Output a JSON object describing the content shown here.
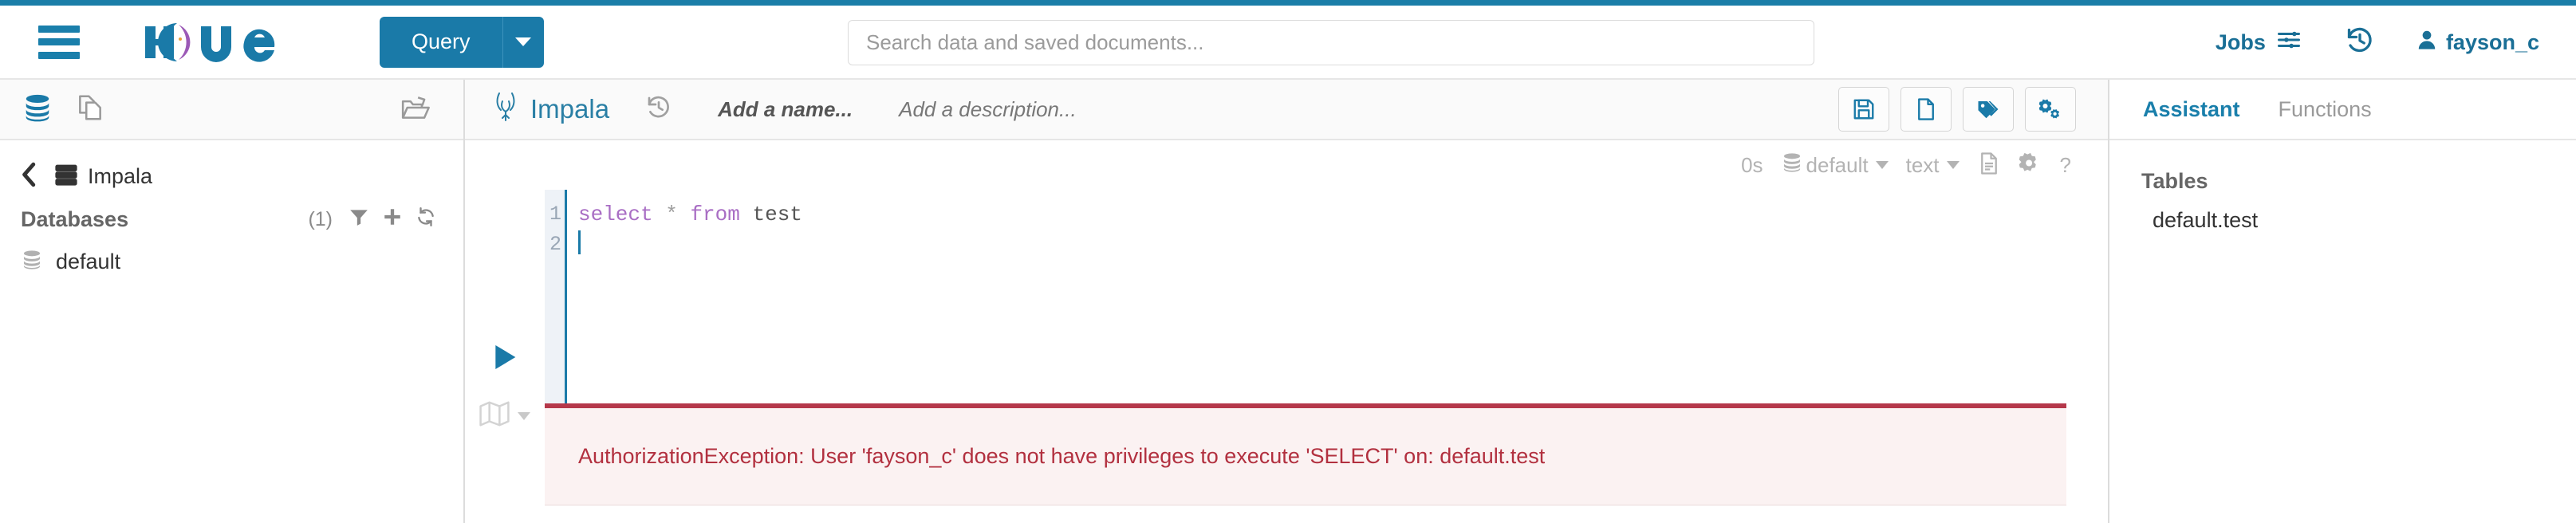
{
  "app": {
    "brand": "Hue",
    "accent_color": "#1a7aa8",
    "error_color": "#b2303f"
  },
  "navbar": {
    "menu_icon": "hamburger-icon",
    "logo_icon": "hue-logo",
    "query_button": "Query",
    "query_caret_icon": "chevron-down-icon",
    "search": {
      "placeholder": "Search data and saved documents...",
      "value": "",
      "icon": "search-icon"
    },
    "jobs_label": "Jobs",
    "jobs_icon": "sliders-icon",
    "history_icon": "history-icon",
    "user_icon": "user-icon",
    "user_name": "fayson_c"
  },
  "left_panel": {
    "header_icons": [
      {
        "name": "database-icon",
        "state": "active"
      },
      {
        "name": "documents-icon",
        "state": "inactive"
      },
      {
        "name": "folder-open-icon",
        "state": "inactive"
      }
    ],
    "back_icon": "chevron-left-icon",
    "source_icon": "server-icon",
    "source_label": "Impala",
    "databases_label": "Databases",
    "databases_count": "(1)",
    "action_icons": [
      "filter-icon",
      "plus-icon",
      "refresh-icon"
    ],
    "databases": [
      {
        "icon": "database-icon",
        "name": "default"
      }
    ]
  },
  "editor": {
    "engine_icon": "impala-logo",
    "engine_name": "Impala",
    "history_icon": "history-icon",
    "name_placeholder": "Add a name...",
    "description_placeholder": "Add a description...",
    "action_buttons": [
      {
        "name": "save-button",
        "icon": "floppy-disk-icon"
      },
      {
        "name": "new-document-button",
        "icon": "file-icon"
      },
      {
        "name": "tags-button",
        "icon": "tags-icon"
      },
      {
        "name": "settings-button",
        "icon": "gears-icon"
      }
    ],
    "toolbar": {
      "duration": "0s",
      "database_icon": "database-icon",
      "database": "default",
      "format": "text",
      "result_icon": "file-text-icon",
      "settings_icon": "gear-icon",
      "help_icon": "question-mark-icon"
    },
    "run_icon": "play-icon",
    "explain_icon": "map-icon",
    "gutter_lines": [
      "1",
      "2"
    ],
    "query": {
      "tokens": [
        {
          "text": "select",
          "type": "keyword"
        },
        {
          "text": " ",
          "type": "plain"
        },
        {
          "text": "*",
          "type": "operator"
        },
        {
          "text": " ",
          "type": "plain"
        },
        {
          "text": "from",
          "type": "keyword"
        },
        {
          "text": " ",
          "type": "plain"
        },
        {
          "text": "test",
          "type": "identifier"
        }
      ],
      "full_text": "select * from test"
    },
    "error_message": "AuthorizationException: User 'fayson_c' does not have privileges to execute 'SELECT' on: default.test"
  },
  "right_panel": {
    "tabs": [
      {
        "label": "Assistant",
        "active": true
      },
      {
        "label": "Functions",
        "active": false
      }
    ],
    "tables_title": "Tables",
    "tables": [
      {
        "name": "default.test"
      }
    ]
  }
}
